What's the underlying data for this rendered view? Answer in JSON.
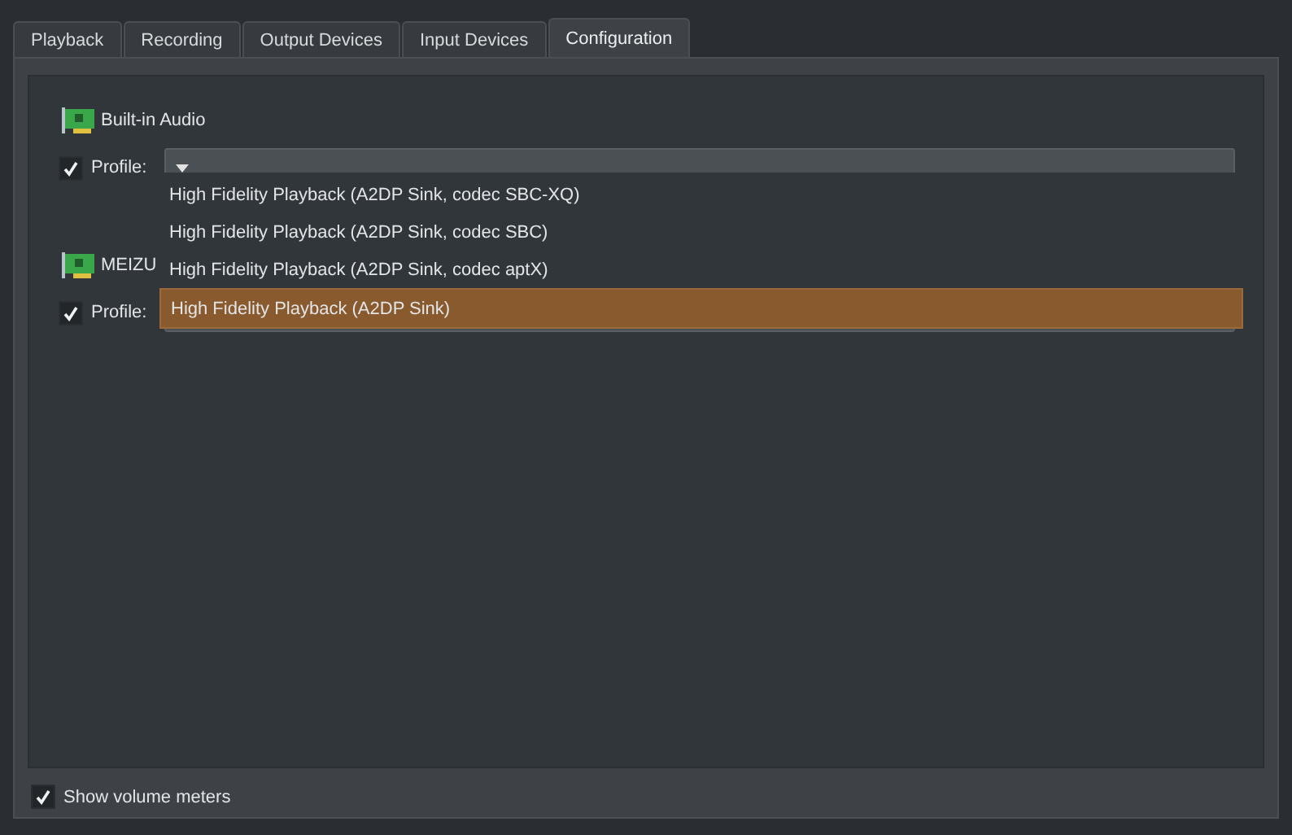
{
  "tabs": [
    {
      "label": "Playback",
      "selected": false
    },
    {
      "label": "Recording",
      "selected": false
    },
    {
      "label": "Output Devices",
      "selected": false
    },
    {
      "label": "Input Devices",
      "selected": false
    },
    {
      "label": "Configuration",
      "selected": true
    }
  ],
  "devices": [
    {
      "name": "Built-in Audio",
      "profile_checked": true,
      "profile_label": "Profile:"
    },
    {
      "name": "MEIZU",
      "profile_checked": true,
      "profile_label": "Profile:"
    }
  ],
  "profile_menu": {
    "items": [
      {
        "label": "High Fidelity Playback (A2DP Sink, codec SBC-XQ)",
        "selected": false
      },
      {
        "label": "High Fidelity Playback (A2DP Sink, codec SBC)",
        "selected": false
      },
      {
        "label": "High Fidelity Playback (A2DP Sink, codec aptX)",
        "selected": false
      },
      {
        "label": "High Fidelity Playback (A2DP Sink)",
        "selected": true
      }
    ]
  },
  "show_volume_meters": {
    "label": "Show volume meters",
    "checked": true
  }
}
